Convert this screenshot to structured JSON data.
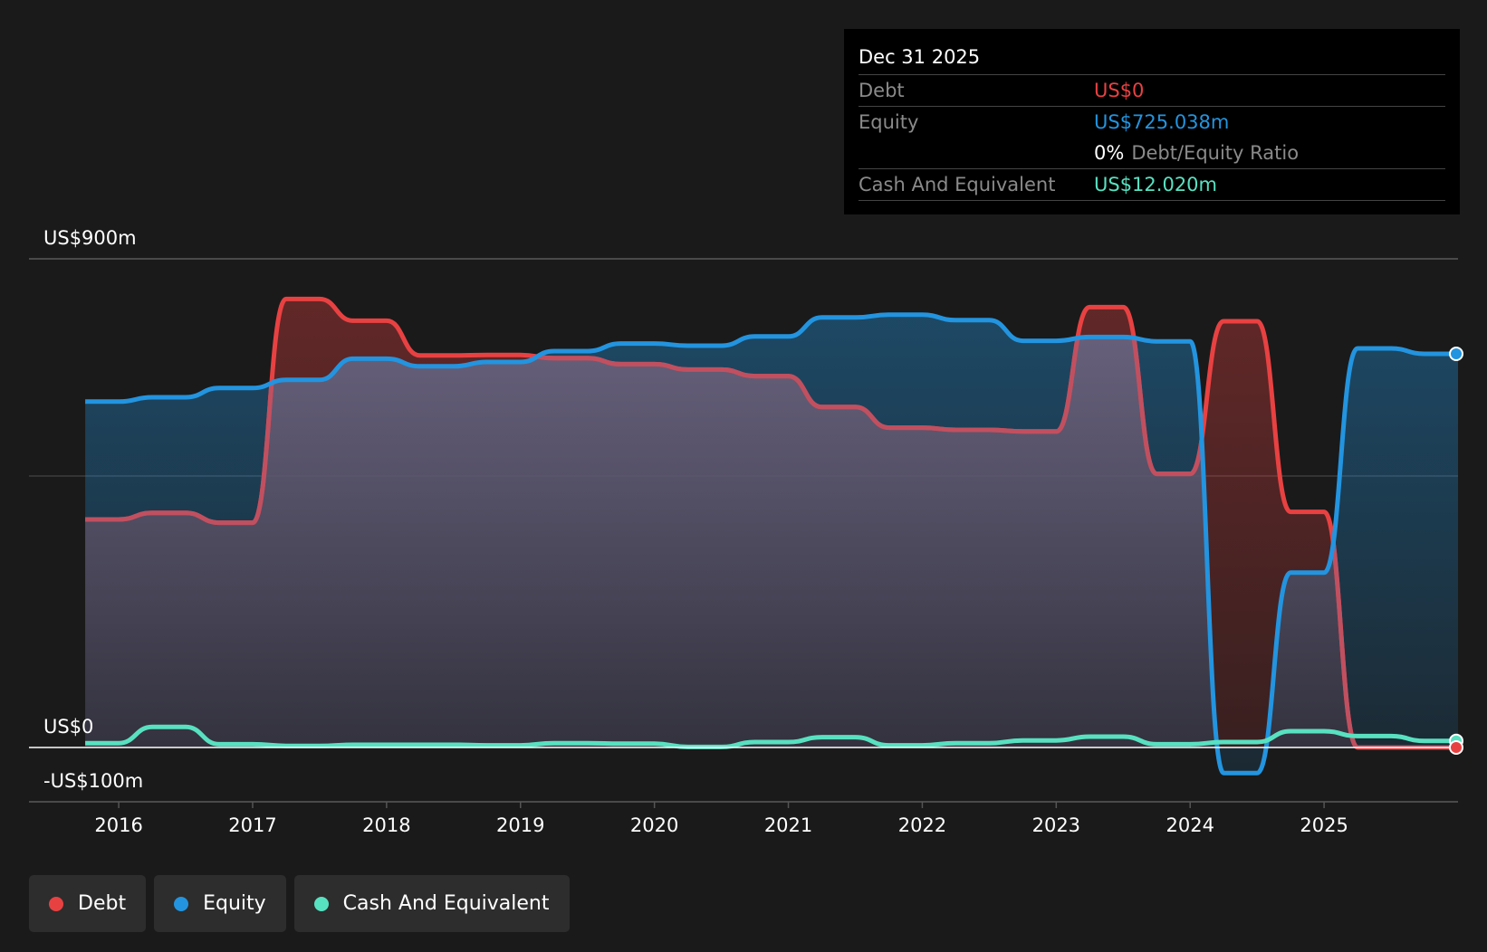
{
  "colors": {
    "background": "#1a1a1a",
    "debt": "#e84142",
    "equity": "#2394df",
    "cash": "#58e1c1",
    "text": "#ffffff",
    "muted": "#8a8a8a"
  },
  "tooltip": {
    "date": "Dec 31 2025",
    "debt_label": "Debt",
    "debt_value": "US$0",
    "equity_label": "Equity",
    "equity_value": "US$725.038m",
    "ratio_value": "0%",
    "ratio_label": "Debt/Equity Ratio",
    "cash_label": "Cash And Equivalent",
    "cash_value": "US$12.020m"
  },
  "legend": [
    {
      "name": "Debt",
      "color": "#e84142"
    },
    {
      "name": "Equity",
      "color": "#2394df"
    },
    {
      "name": "Cash And Equivalent",
      "color": "#58e1c1"
    }
  ],
  "chart_data": {
    "type": "area",
    "title": "",
    "xlabel": "",
    "ylabel": "",
    "x_ticks": [
      2016,
      2017,
      2018,
      2019,
      2020,
      2021,
      2022,
      2023,
      2024,
      2025
    ],
    "y_tick_labels": [
      {
        "value": 900,
        "label": "US$900m"
      },
      {
        "value": 0,
        "label": "US$0"
      },
      {
        "value": -100,
        "label": "-US$100m"
      }
    ],
    "xlim": [
      2015.33,
      2026.0
    ],
    "ylim": [
      -100,
      900
    ],
    "grid": true,
    "legend_position": "bottom-left",
    "series": [
      {
        "name": "Debt",
        "color": "#e84142",
        "points": [
          [
            2015.75,
            420
          ],
          [
            2016.0,
            420
          ],
          [
            2016.25,
            432
          ],
          [
            2016.5,
            432
          ],
          [
            2016.75,
            414
          ],
          [
            2017.0,
            414
          ],
          [
            2017.25,
            826
          ],
          [
            2017.5,
            826
          ],
          [
            2017.75,
            786
          ],
          [
            2018.0,
            786
          ],
          [
            2018.25,
            722
          ],
          [
            2018.5,
            722
          ],
          [
            2018.75,
            723
          ],
          [
            2019.0,
            723
          ],
          [
            2019.25,
            717
          ],
          [
            2019.5,
            717
          ],
          [
            2019.75,
            706
          ],
          [
            2020.0,
            706
          ],
          [
            2020.25,
            696
          ],
          [
            2020.5,
            696
          ],
          [
            2020.75,
            684
          ],
          [
            2021.0,
            684
          ],
          [
            2021.25,
            627
          ],
          [
            2021.5,
            627
          ],
          [
            2021.75,
            589
          ],
          [
            2022.0,
            589
          ],
          [
            2022.25,
            585
          ],
          [
            2022.5,
            585
          ],
          [
            2022.75,
            582
          ],
          [
            2023.0,
            582
          ],
          [
            2023.25,
            811
          ],
          [
            2023.5,
            811
          ],
          [
            2023.75,
            504
          ],
          [
            2024.0,
            504
          ],
          [
            2024.25,
            785
          ],
          [
            2024.5,
            785
          ],
          [
            2024.75,
            434
          ],
          [
            2025.0,
            434
          ],
          [
            2025.25,
            0
          ],
          [
            2025.5,
            0
          ],
          [
            2025.75,
            0
          ],
          [
            2026.0,
            0
          ]
        ]
      },
      {
        "name": "Equity",
        "color": "#2394df",
        "points": [
          [
            2015.75,
            637
          ],
          [
            2016.0,
            637
          ],
          [
            2016.25,
            645
          ],
          [
            2016.5,
            645
          ],
          [
            2016.75,
            662
          ],
          [
            2017.0,
            662
          ],
          [
            2017.25,
            677
          ],
          [
            2017.5,
            677
          ],
          [
            2017.75,
            716
          ],
          [
            2018.0,
            716
          ],
          [
            2018.25,
            702
          ],
          [
            2018.5,
            702
          ],
          [
            2018.75,
            710
          ],
          [
            2019.0,
            710
          ],
          [
            2019.25,
            730
          ],
          [
            2019.5,
            730
          ],
          [
            2019.75,
            744
          ],
          [
            2020.0,
            744
          ],
          [
            2020.25,
            740
          ],
          [
            2020.5,
            740
          ],
          [
            2020.75,
            757
          ],
          [
            2021.0,
            757
          ],
          [
            2021.25,
            792
          ],
          [
            2021.5,
            792
          ],
          [
            2021.75,
            797
          ],
          [
            2022.0,
            797
          ],
          [
            2022.25,
            787
          ],
          [
            2022.5,
            787
          ],
          [
            2022.75,
            749
          ],
          [
            2023.0,
            749
          ],
          [
            2023.25,
            756
          ],
          [
            2023.5,
            756
          ],
          [
            2023.75,
            748
          ],
          [
            2024.0,
            748
          ],
          [
            2024.25,
            -47
          ],
          [
            2024.5,
            -47
          ],
          [
            2024.75,
            322
          ],
          [
            2025.0,
            322
          ],
          [
            2025.25,
            735
          ],
          [
            2025.5,
            735
          ],
          [
            2025.75,
            725
          ],
          [
            2026.0,
            725
          ]
        ]
      },
      {
        "name": "Cash And Equivalent",
        "color": "#58e1c1",
        "points": [
          [
            2015.75,
            8
          ],
          [
            2016.0,
            8
          ],
          [
            2016.25,
            38
          ],
          [
            2016.5,
            38
          ],
          [
            2016.75,
            6
          ],
          [
            2017.0,
            6
          ],
          [
            2017.25,
            3
          ],
          [
            2017.5,
            3
          ],
          [
            2017.75,
            5
          ],
          [
            2018.0,
            5
          ],
          [
            2018.25,
            5
          ],
          [
            2018.5,
            5
          ],
          [
            2018.75,
            4
          ],
          [
            2019.0,
            4
          ],
          [
            2019.25,
            8
          ],
          [
            2019.5,
            8
          ],
          [
            2019.75,
            7
          ],
          [
            2020.0,
            7
          ],
          [
            2020.25,
            1
          ],
          [
            2020.5,
            1
          ],
          [
            2020.75,
            10
          ],
          [
            2021.0,
            10
          ],
          [
            2021.25,
            19
          ],
          [
            2021.5,
            19
          ],
          [
            2021.75,
            4
          ],
          [
            2022.0,
            4
          ],
          [
            2022.25,
            8
          ],
          [
            2022.5,
            8
          ],
          [
            2022.75,
            13
          ],
          [
            2023.0,
            13
          ],
          [
            2023.25,
            20
          ],
          [
            2023.5,
            20
          ],
          [
            2023.75,
            6
          ],
          [
            2024.0,
            6
          ],
          [
            2024.25,
            10
          ],
          [
            2024.5,
            10
          ],
          [
            2024.75,
            30
          ],
          [
            2025.0,
            30
          ],
          [
            2025.25,
            21
          ],
          [
            2025.5,
            21
          ],
          [
            2025.75,
            12
          ],
          [
            2026.0,
            12
          ]
        ]
      }
    ]
  }
}
